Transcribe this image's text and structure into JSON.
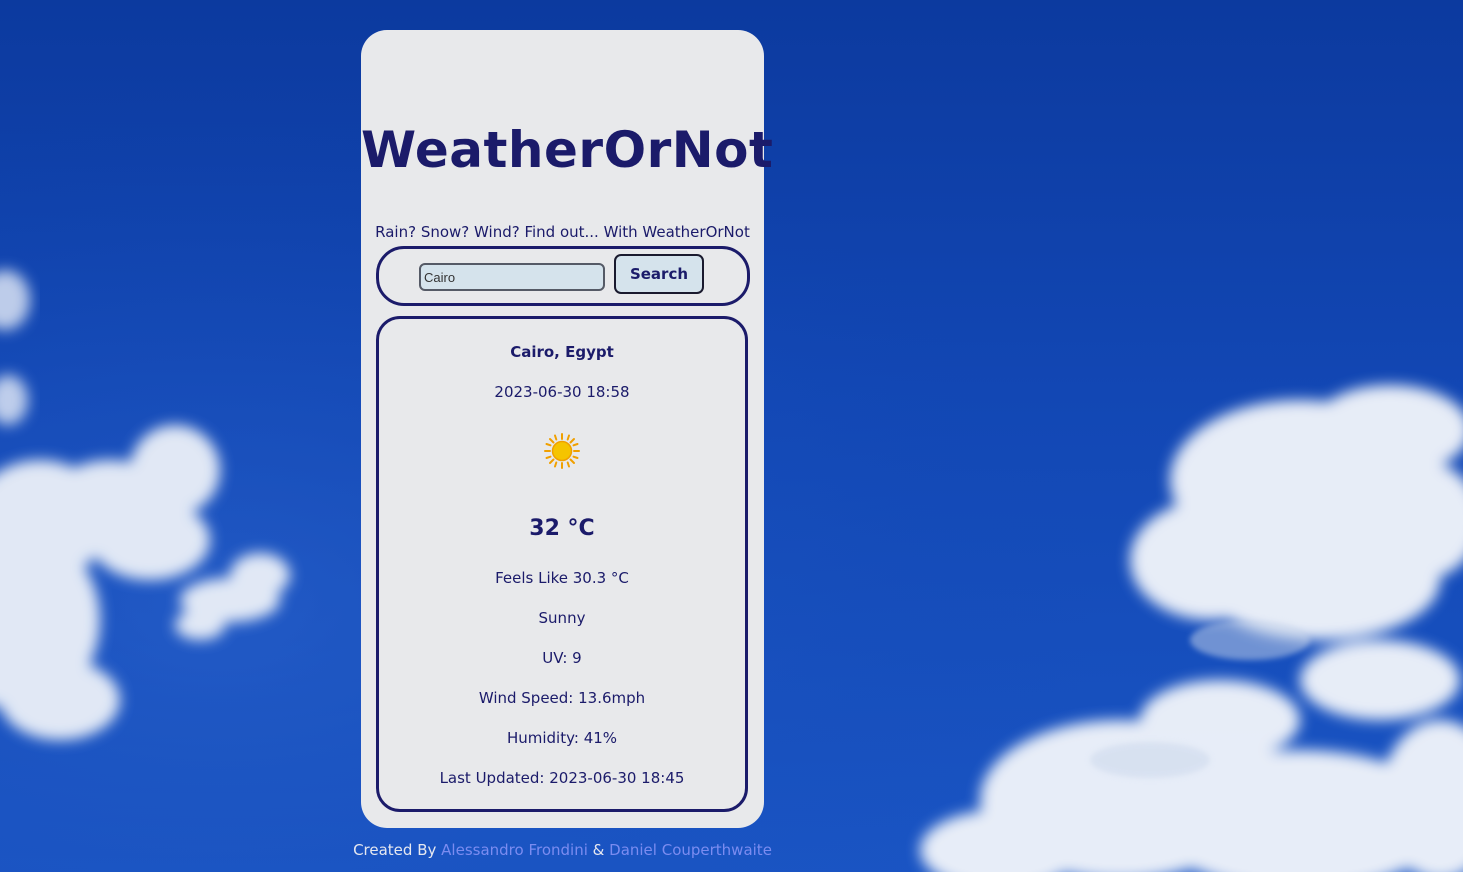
{
  "app": {
    "title": "WeatherOrNot",
    "tagline": "Rain? Snow? Wind? Find out... With WeatherOrNot"
  },
  "search": {
    "value": "Cairo",
    "button_label": "Search"
  },
  "weather": {
    "location": "Cairo, Egypt",
    "local_time": "2023-06-30 18:58",
    "icon": "sun-icon",
    "temperature": "32 °C",
    "feels_like": "Feels Like 30.3 °C",
    "condition": "Sunny",
    "uv": "UV: 9",
    "wind": "Wind Speed: 13.6mph",
    "humidity": "Humidity: 41%",
    "last_updated": "Last Updated: 2023-06-30 18:45"
  },
  "footer": {
    "prefix": "Created By",
    "author1": "Alessandro Frondini",
    "separator": "&",
    "author2": "Daniel Couperthwaite"
  },
  "colors": {
    "accent": "#1b1b6a",
    "card_bg": "#e8e9eb",
    "input_bg": "#d5e3ec",
    "link": "#7b8cf0",
    "sky": "#1247b4"
  }
}
